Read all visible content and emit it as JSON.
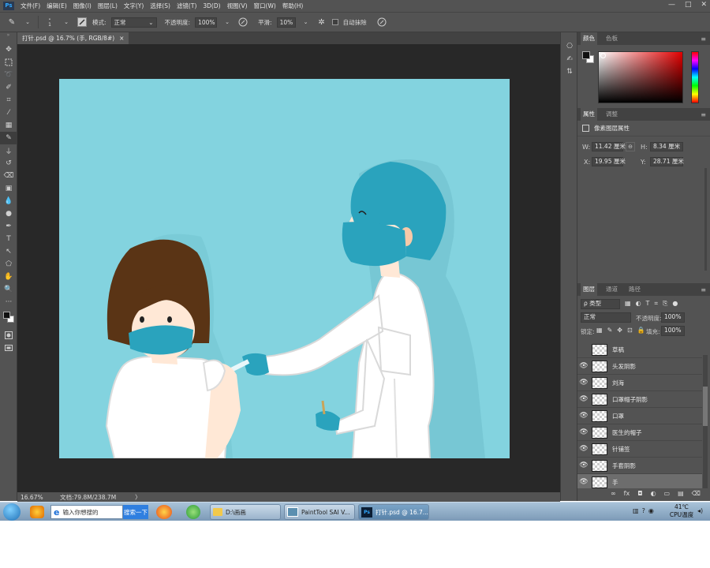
{
  "menubar": {
    "logo": "Ps",
    "items": [
      "文件(F)",
      "编辑(E)",
      "图像(I)",
      "图层(L)",
      "文字(Y)",
      "选择(S)",
      "滤镜(T)",
      "3D(D)",
      "视图(V)",
      "窗口(W)",
      "帮助(H)"
    ],
    "minimize": "—",
    "maximize": "□",
    "close": "✕"
  },
  "options": {
    "brush_size": "1",
    "mode_label": "模式:",
    "mode_value": "正常",
    "opacity_label": "不透明度:",
    "opacity_value": "100%",
    "smooth_label": "平滑:",
    "smooth_value": "10%",
    "auto_erase_label": "自动抹除"
  },
  "document": {
    "tab_title": "打针.psd @ 16.7% (手, RGB/8#)",
    "tab_close": "×",
    "zoom": "16.67%",
    "doc_size": "文档:79.8M/238.7M",
    "status_arrow": "〉"
  },
  "color_panel": {
    "tabs": [
      "颜色",
      "色板"
    ],
    "hue_colors": [
      "#ff0000",
      "#ff00ff",
      "#0000ff",
      "#00ffff",
      "#00ff00",
      "#ffff00",
      "#ff0000"
    ],
    "base_color": "#e30000"
  },
  "properties_panel": {
    "tabs": [
      "属性",
      "调整"
    ],
    "heading": "像素图层属性",
    "w_label": "W:",
    "w_value": "11.42 厘米",
    "h_label": "H:",
    "h_value": "8.34 厘米",
    "x_label": "X:",
    "x_value": "19.95 厘米",
    "y_label": "Y:",
    "y_value": "28.71 厘米",
    "link_icon": "⊖"
  },
  "layers_panel": {
    "tabs": [
      "图层",
      "通道",
      "路径"
    ],
    "filter_label": "ρ 类型",
    "blend_mode": "正常",
    "opacity_label": "不透明度:",
    "opacity_value": "100%",
    "lock_label": "锁定:",
    "fill_label": "填充:",
    "fill_value": "100%",
    "layers": [
      {
        "name": "草稿",
        "visible": false,
        "selected": false
      },
      {
        "name": "头发阴影",
        "visible": true,
        "selected": false
      },
      {
        "name": "刘海",
        "visible": true,
        "selected": false
      },
      {
        "name": "口罩帽子阴影",
        "visible": true,
        "selected": false
      },
      {
        "name": "口罩",
        "visible": true,
        "selected": false
      },
      {
        "name": "医生的帽子",
        "visible": true,
        "selected": false
      },
      {
        "name": "针铺签",
        "visible": true,
        "selected": false
      },
      {
        "name": "手套阴影",
        "visible": true,
        "selected": false
      },
      {
        "name": "手",
        "visible": true,
        "selected": true
      }
    ],
    "footer_icons": [
      "∞",
      "fx",
      "◘",
      "◐",
      "▭",
      "▤",
      "⌫"
    ]
  },
  "taskbar": {
    "search_placeholder": "输入你想搜的",
    "search_button": "搜索一下",
    "folder_label": "D:\\画画",
    "sai_label": "PaintTool SAI V...",
    "ps_label": "打针.psd @ 16.7...",
    "temperature": "41℃",
    "temp_label": "CPU温度"
  },
  "colors": {
    "canvas_bg": "#83d3df",
    "teal_accent": "#2aa3bd",
    "hair": "#5a3415",
    "skin": "#ffe8d6"
  }
}
